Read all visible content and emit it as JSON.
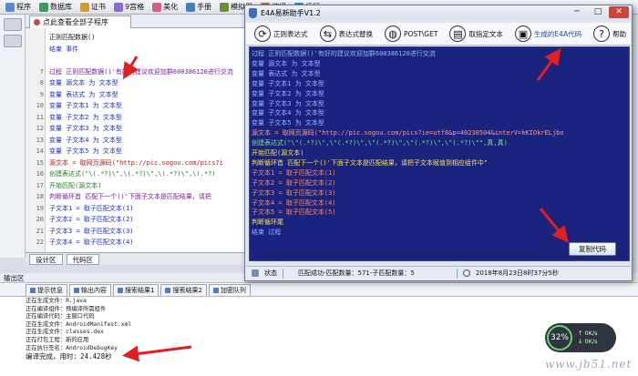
{
  "ide": {
    "toolbar_items": [
      "程序",
      "数据库",
      "证书",
      "9宫格",
      "美化",
      "手册",
      "模拟器",
      "编译",
      "运行"
    ],
    "editor_tab_label": "点此查看全部子程序",
    "bottom_tabs": [
      "设计区",
      "代码区"
    ],
    "code_lines": [
      {
        "ln": "",
        "text": "正则匹配数据()",
        "cls": ""
      },
      {
        "ln": "",
        "text": "结束 事件",
        "cls": "kw-blue"
      },
      {
        "ln": "",
        "text": "",
        "cls": ""
      },
      {
        "ln": "7",
        "text": "过程 正则匹配数据()'有好的建议欢迎加群600386120进行交流",
        "cls": "kw-purple"
      },
      {
        "ln": "8",
        "text": "  变量 源文本 为 文本型",
        "cls": "kw-blue"
      },
      {
        "ln": "9",
        "text": "  变量 表达式 为 文本型",
        "cls": "kw-blue"
      },
      {
        "ln": "10",
        "text": "  变量 子文本1 为 文本型",
        "cls": "kw-blue"
      },
      {
        "ln": "11",
        "text": "  变量 子文本2 为 文本型",
        "cls": "kw-blue"
      },
      {
        "ln": "12",
        "text": "  变量 子文本3 为 文本型",
        "cls": "kw-blue"
      },
      {
        "ln": "13",
        "text": "  变量 子文本4 为 文本型",
        "cls": "kw-blue"
      },
      {
        "ln": "14",
        "text": "  变量 子文本5 为 文本型",
        "cls": "kw-blue"
      },
      {
        "ln": "15",
        "text": "  源文本 = 取网页源码(\"http://pic.sogou.com/pics?i",
        "cls": "kw-red"
      },
      {
        "ln": "16",
        "text": "  创建表达式(\"\\(.*?)\\\",\\(.*?)\\\",\\(.*?)\\\",\\(.*?)",
        "cls": "kw-green"
      },
      {
        "ln": "17",
        "text": "  开始匹配(源文本)",
        "cls": "kw-green"
      },
      {
        "ln": "18",
        "text": "  判断循环首 匹配下一个()'下面子文本是匹配结果，请把",
        "cls": "kw-purple"
      },
      {
        "ln": "19",
        "text": "      子文本1 = 取子匹配文本(1)",
        "cls": "kw-blue"
      },
      {
        "ln": "20",
        "text": "      子文本2 = 取子匹配文本(2)",
        "cls": "kw-blue"
      },
      {
        "ln": "21",
        "text": "      子文本3 = 取子匹配文本(3)",
        "cls": "kw-blue"
      },
      {
        "ln": "22",
        "text": "      子文本4 = 取子匹配文本(4)",
        "cls": "kw-blue"
      }
    ]
  },
  "output": {
    "title": "输出区",
    "tabs": [
      "提示信息",
      "输出内容",
      "搜索结果1",
      "搜索结果2",
      "加密队列"
    ],
    "lines": [
      "正在生成文件：R.java",
      "正在编译组件：预编译所需组件",
      "正在编译代码：主窗口代码",
      "正在生成文件：AndroidManifest.xml",
      "正在生成文件：classes.dex",
      "正在打包工程：新的应用",
      "正在执行签名：AndroidDebugKey"
    ],
    "result": "编译完成，用时：24.428秒"
  },
  "net_widget": {
    "percent": "32%",
    "up": "0K/s",
    "down": "0K/s"
  },
  "watermark": "www.jb51.net",
  "tool": {
    "title": "E4A易新助手V1.2",
    "buttons": [
      {
        "label": "正则表达式",
        "icon": "refresh-icon"
      },
      {
        "label": "表达式替换",
        "icon": "swap-icon"
      },
      {
        "label": "POST\\GET",
        "icon": "globe-icon"
      },
      {
        "label": "取指定文本",
        "icon": "document-icon"
      },
      {
        "label": "生成的E4A代码",
        "icon": "code-icon"
      },
      {
        "label": "帮助",
        "icon": "help-icon"
      }
    ],
    "code": [
      {
        "t": "过程 正则匹配数据()'有好的建议欢迎加群600386120进行交流",
        "c": "tw-kw"
      },
      {
        "t": "  变量 源文本 为 文本型",
        "c": "tw-kw"
      },
      {
        "t": "  变量 表达式 为 文本型",
        "c": "tw-kw"
      },
      {
        "t": "  变量 子文本1 为 文本型",
        "c": "tw-kw"
      },
      {
        "t": "  变量 子文本2 为 文本型",
        "c": "tw-kw"
      },
      {
        "t": "  变量 子文本3 为 文本型",
        "c": "tw-kw"
      },
      {
        "t": "  变量 子文本4 为 文本型",
        "c": "tw-kw"
      },
      {
        "t": "  变量 子文本5 为 文本型",
        "c": "tw-kw"
      },
      {
        "t": "  源文本 = 取网页源码(\"http://pic.sogou.com/pics?ie=utf8&p=40230504&interV=kKIOkrELjbo",
        "c": "tw-str"
      },
      {
        "t": "  创建表达式(\"\\\"(.*?)\\\",\\\"(.*?)\\\",\\\"(.*?)\\\",\\\"(.*?)\\\",\\\"(.*?)\\\"\",真,真)",
        "c": "tw-grn"
      },
      {
        "t": "  开始匹配(源文本)",
        "c": "tw-yel"
      },
      {
        "t": "  判断循环首 匹配下一个()'下面子文本是匹配结果，请把子文本赋值到相应组件中\"",
        "c": "tw-yel"
      },
      {
        "t": "      子文本1 = 取子匹配文本(1)",
        "c": "tw-org"
      },
      {
        "t": "      子文本2 = 取子匹配文本(2)",
        "c": "tw-org"
      },
      {
        "t": "      子文本3 = 取子匹配文本(3)",
        "c": "tw-org"
      },
      {
        "t": "      子文本4 = 取子匹配文本(4)",
        "c": "tw-org"
      },
      {
        "t": "      子文本5 = 取子匹配文本(5)",
        "c": "tw-org"
      },
      {
        "t": "  判断循环尾",
        "c": "tw-yel"
      },
      {
        "t": "结束 过程",
        "c": "tw-kw"
      }
    ],
    "copy_button": "复制代码",
    "status": {
      "label": "状态",
      "message": "匹配成功-匹配数量：571-子匹配数量：5",
      "time": "2018年8月23日8时37分5秒"
    }
  },
  "colors": {
    "tool_code_bg": "#1a237e",
    "arrow": "#e02020"
  }
}
